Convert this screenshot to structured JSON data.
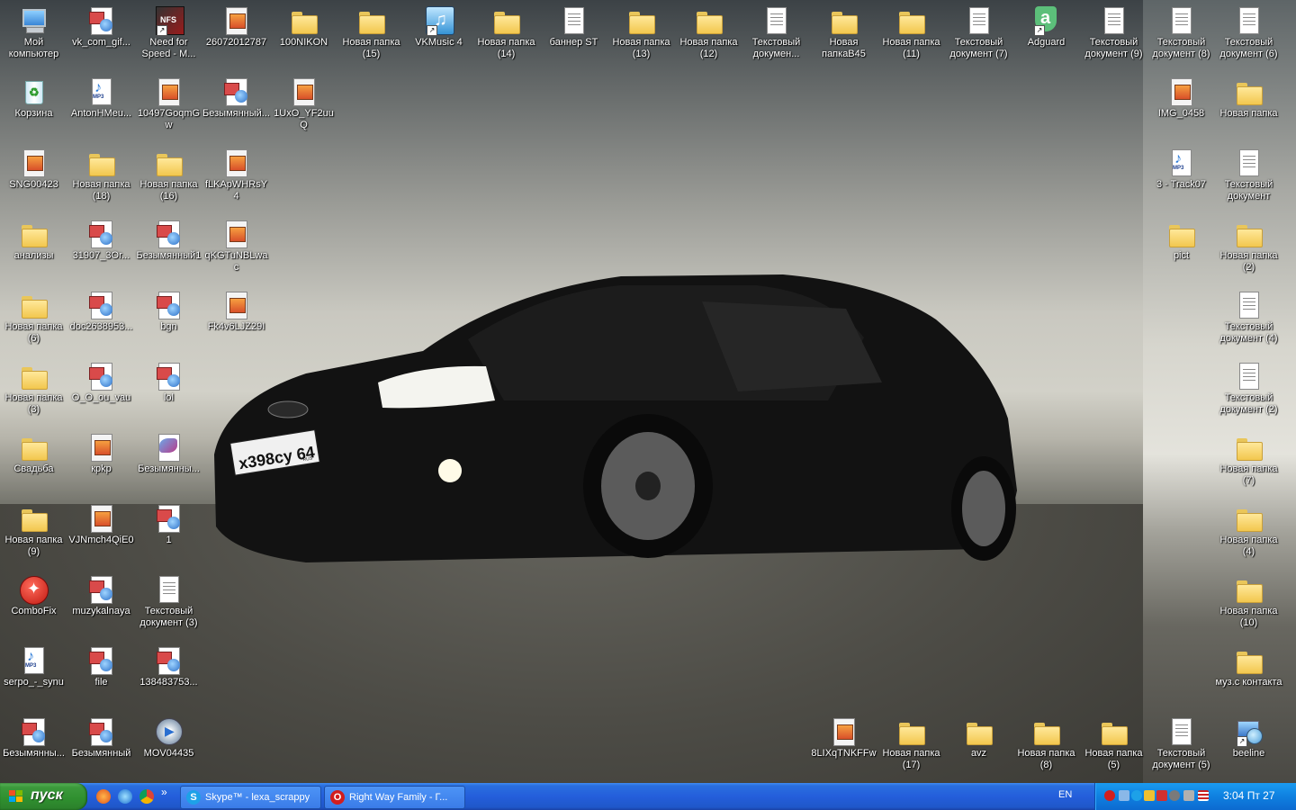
{
  "desktop": {
    "icons": [
      {
        "label": "Мой компьютер",
        "type": "computer"
      },
      {
        "label": "vk_com_gif...",
        "type": "pic2"
      },
      {
        "label": "Need for Speed - M...",
        "type": "game"
      },
      {
        "label": "26072012787",
        "type": "img"
      },
      {
        "label": "100NIKON",
        "type": "folder"
      },
      {
        "label": "Новая папка (15)",
        "type": "folder"
      },
      {
        "label": "VKMusic 4",
        "type": "vk"
      },
      {
        "label": "Новая папка (14)",
        "type": "folder"
      },
      {
        "label": "баннер ST",
        "type": "doc"
      },
      {
        "label": "Новая папка (13)",
        "type": "folder"
      },
      {
        "label": "Новая папка (12)",
        "type": "folder"
      },
      {
        "label": "Текстовый докумен...",
        "type": "doc"
      },
      {
        "label": "Новая папкаВ45",
        "type": "folder"
      },
      {
        "label": "Новая папка (11)",
        "type": "folder"
      },
      {
        "label": "Текстовый документ (7)",
        "type": "doc"
      },
      {
        "label": "Adguard",
        "type": "adguard"
      },
      {
        "label": "Текстовый документ (9)",
        "type": "doc"
      },
      {
        "label": "Текстовый документ (8)",
        "type": "doc"
      },
      {
        "label": "Текстовый документ (6)",
        "type": "doc"
      },
      {
        "label": "Корзина",
        "type": "recycle"
      },
      {
        "label": "AntonHMeu...",
        "type": "mp3"
      },
      {
        "label": "10497GoqmGw",
        "type": "img"
      },
      {
        "label": "Безымянный...",
        "type": "pic2"
      },
      {
        "label": "1UxO_YF2uuQ",
        "type": "img"
      },
      {
        "label": "IMG_0458",
        "type": "img"
      },
      {
        "label": "Новая папка",
        "type": "folder"
      },
      {
        "label": "SNG00423",
        "type": "img"
      },
      {
        "label": "Новая папка (18)",
        "type": "folder"
      },
      {
        "label": "Новая папка (16)",
        "type": "folder"
      },
      {
        "label": "fLKApWHRsY4",
        "type": "img"
      },
      {
        "label": "3 - Track07",
        "type": "mp3"
      },
      {
        "label": "Текстовый документ",
        "type": "doc"
      },
      {
        "label": "анализы",
        "type": "folder"
      },
      {
        "label": "31907_3Or...",
        "type": "pic2"
      },
      {
        "label": "Безымянный1",
        "type": "pic2"
      },
      {
        "label": "qKGTuNBLwac",
        "type": "img"
      },
      {
        "label": "pict",
        "type": "folder"
      },
      {
        "label": "Новая папка (2)",
        "type": "folder"
      },
      {
        "label": "Новая папка (6)",
        "type": "folder"
      },
      {
        "label": "doc2638953...",
        "type": "pic2"
      },
      {
        "label": "bgn",
        "type": "pic2"
      },
      {
        "label": "Fk4v6LJZ29I",
        "type": "img"
      },
      {
        "label": "Текстовый документ (4)",
        "type": "doc"
      },
      {
        "label": "Новая папка (3)",
        "type": "folder"
      },
      {
        "label": "O_O_ou_vau",
        "type": "pic2"
      },
      {
        "label": "lol",
        "type": "pic2"
      },
      {
        "label": "Текстовый документ (2)",
        "type": "doc"
      },
      {
        "label": "Свадьба",
        "type": "folder"
      },
      {
        "label": "крkр",
        "type": "img"
      },
      {
        "label": "Безымянны...",
        "type": "paint"
      },
      {
        "label": "Новая папка (7)",
        "type": "folder"
      },
      {
        "label": "Новая папка (9)",
        "type": "folder"
      },
      {
        "label": "VJNmch4QiE0",
        "type": "img"
      },
      {
        "label": "1",
        "type": "pic2"
      },
      {
        "label": "Новая папка (4)",
        "type": "folder"
      },
      {
        "label": "ComboFix",
        "type": "combofix"
      },
      {
        "label": "muzykalnaya",
        "type": "pic2"
      },
      {
        "label": "Текстовый документ (3)",
        "type": "doc"
      },
      {
        "label": "Новая папка (10)",
        "type": "folder"
      },
      {
        "label": "serpo_-_synu",
        "type": "mp3"
      },
      {
        "label": "file",
        "type": "pic2"
      },
      {
        "label": "138483753...",
        "type": "pic2"
      },
      {
        "label": "муз.с контакта",
        "type": "folder"
      },
      {
        "label": "Безымянны...",
        "type": "pic2"
      },
      {
        "label": "Безымянный",
        "type": "pic2"
      },
      {
        "label": "MOV04435",
        "type": "mov"
      },
      {
        "label": "8LIXqTNKFFw",
        "type": "img"
      },
      {
        "label": "Новая папка (17)",
        "type": "folder"
      },
      {
        "label": "avz",
        "type": "folder"
      },
      {
        "label": "Новая папка (8)",
        "type": "folder"
      },
      {
        "label": "Новая папка (5)",
        "type": "folder"
      },
      {
        "label": "Текстовый документ (5)",
        "type": "doc"
      },
      {
        "label": "beeline",
        "type": "net"
      }
    ],
    "license_plate": "х398су 64",
    "plate_region": "RUS"
  },
  "taskbar": {
    "start_label": "пуск",
    "tasks": [
      {
        "label": "Skype™ - lexa_scrappy",
        "icon": "skype-icon",
        "letter": "S",
        "color": "#1da1e8"
      },
      {
        "label": "Right Way Family - Г...",
        "icon": "opera-icon",
        "letter": "O",
        "color": "#d21e1e"
      }
    ],
    "language": "EN",
    "clock": "3:04 Пт 27"
  }
}
